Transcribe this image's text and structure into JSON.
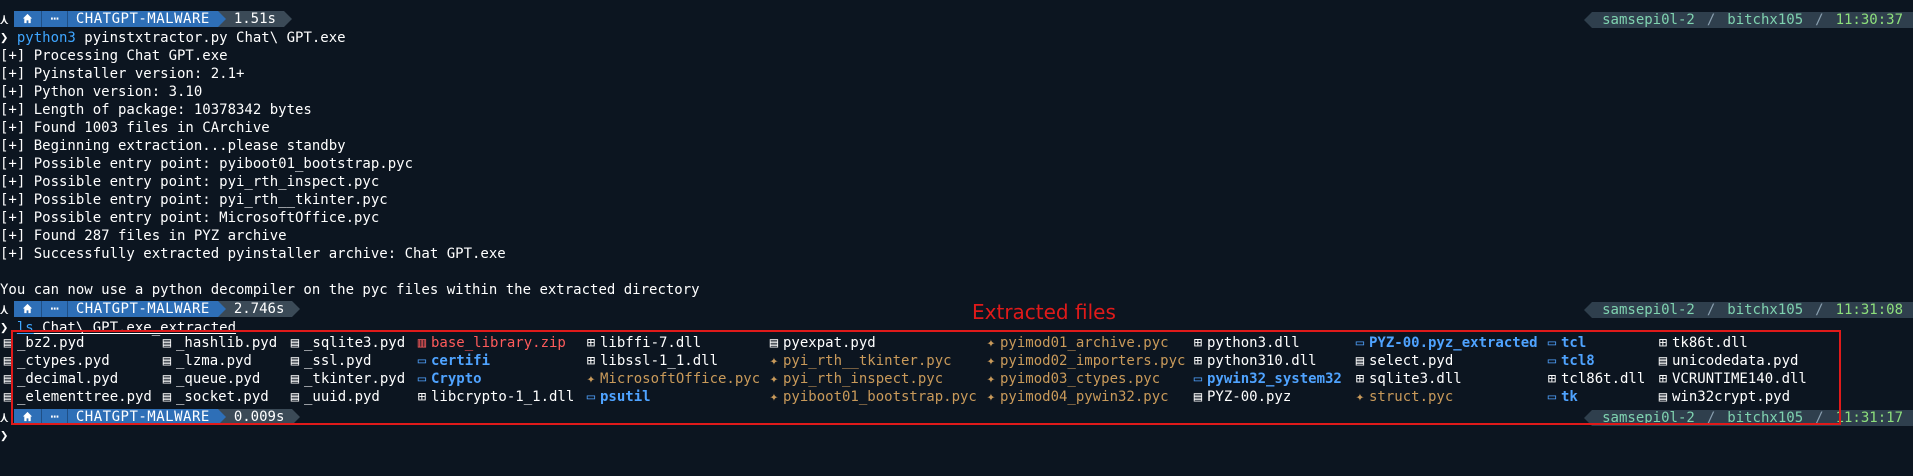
{
  "prompt": {
    "symbol": "⋏",
    "home_icon": "home-icon",
    "dots": "⋯",
    "dir": "CHATGPT-MALWARE",
    "host": "samsepi0l-2",
    "user": "bitchx105",
    "arrow": "❯"
  },
  "prompts": [
    {
      "duration": "1.51s",
      "time": "11:30:37"
    },
    {
      "duration": "2.746s",
      "time": "11:31:08"
    },
    {
      "duration": "0.009s",
      "time": "11:31:17"
    }
  ],
  "command1": {
    "program": "python3",
    "args": "pyinstxtractor.py Chat\\ GPT.exe"
  },
  "output": [
    "[+] Processing Chat GPT.exe",
    "[+] Pyinstaller version: 2.1+",
    "[+] Python version: 3.10",
    "[+] Length of package: 10378342 bytes",
    "[+] Found 1003 files in CArchive",
    "[+] Beginning extraction...please standby",
    "[+] Possible entry point: pyiboot01_bootstrap.pyc",
    "[+] Possible entry point: pyi_rth_inspect.pyc",
    "[+] Possible entry point: pyi_rth__tkinter.pyc",
    "[+] Possible entry point: MicrosoftOffice.pyc",
    "[+] Found 287 files in PYZ archive",
    "[+] Successfully extracted pyinstaller archive: Chat GPT.exe",
    "",
    "You can now use a python decompiler on the pyc files within the extracted directory"
  ],
  "command2": {
    "program": "ls",
    "args": "Chat\\ GPT.exe_extracted"
  },
  "annotation": "Extracted files",
  "files": [
    [
      {
        "name": "_bz2.pyd",
        "kind": "file"
      },
      {
        "name": "_ctypes.pyd",
        "kind": "file"
      },
      {
        "name": "_decimal.pyd",
        "kind": "file"
      },
      {
        "name": "_elementtree.pyd",
        "kind": "file"
      }
    ],
    [
      {
        "name": "_hashlib.pyd",
        "kind": "file"
      },
      {
        "name": "_lzma.pyd",
        "kind": "file"
      },
      {
        "name": "_queue.pyd",
        "kind": "file"
      },
      {
        "name": "_socket.pyd",
        "kind": "file"
      }
    ],
    [
      {
        "name": "_sqlite3.pyd",
        "kind": "file"
      },
      {
        "name": "_ssl.pyd",
        "kind": "file"
      },
      {
        "name": "_tkinter.pyd",
        "kind": "file"
      },
      {
        "name": "_uuid.pyd",
        "kind": "file"
      }
    ],
    [
      {
        "name": "base_library.zip",
        "kind": "zip"
      },
      {
        "name": "certifi",
        "kind": "dir"
      },
      {
        "name": "Crypto",
        "kind": "dir"
      },
      {
        "name": "libcrypto-1_1.dll",
        "kind": "dll"
      }
    ],
    [
      {
        "name": "libffi-7.dll",
        "kind": "dll"
      },
      {
        "name": "libssl-1_1.dll",
        "kind": "dll"
      },
      {
        "name": "MicrosoftOffice.pyc",
        "kind": "pyc"
      },
      {
        "name": "psutil",
        "kind": "dir"
      }
    ],
    [
      {
        "name": "pyexpat.pyd",
        "kind": "file"
      },
      {
        "name": "pyi_rth__tkinter.pyc",
        "kind": "pyc"
      },
      {
        "name": "pyi_rth_inspect.pyc",
        "kind": "pyc"
      },
      {
        "name": "pyiboot01_bootstrap.pyc",
        "kind": "pyc"
      }
    ],
    [
      {
        "name": "pyimod01_archive.pyc",
        "kind": "pyc"
      },
      {
        "name": "pyimod02_importers.pyc",
        "kind": "pyc"
      },
      {
        "name": "pyimod03_ctypes.pyc",
        "kind": "pyc"
      },
      {
        "name": "pyimod04_pywin32.pyc",
        "kind": "pyc"
      }
    ],
    [
      {
        "name": "python3.dll",
        "kind": "dll"
      },
      {
        "name": "python310.dll",
        "kind": "dll"
      },
      {
        "name": "pywin32_system32",
        "kind": "dir"
      },
      {
        "name": "PYZ-00.pyz",
        "kind": "file"
      }
    ],
    [
      {
        "name": "PYZ-00.pyz_extracted",
        "kind": "dir"
      },
      {
        "name": "select.pyd",
        "kind": "file"
      },
      {
        "name": "sqlite3.dll",
        "kind": "dll"
      },
      {
        "name": "struct.pyc",
        "kind": "pyc"
      }
    ],
    [
      {
        "name": "tcl",
        "kind": "dir"
      },
      {
        "name": "tcl8",
        "kind": "dir"
      },
      {
        "name": "tcl86t.dll",
        "kind": "dll"
      },
      {
        "name": "tk",
        "kind": "dir"
      }
    ],
    [
      {
        "name": "tk86t.dll",
        "kind": "dll"
      },
      {
        "name": "unicodedata.pyd",
        "kind": "file"
      },
      {
        "name": "VCRUNTIME140.dll",
        "kind": "dll"
      },
      {
        "name": "win32crypt.pyd",
        "kind": "file"
      }
    ]
  ],
  "colors": {
    "background": "#0c1520",
    "prompt_blue": "#2e6fb7",
    "highlight_box": "#e01a1a",
    "dir": "#4fa3ff",
    "zip": "#ff5b5b",
    "pyc": "#c99a5a",
    "time": "#8ee07c"
  }
}
